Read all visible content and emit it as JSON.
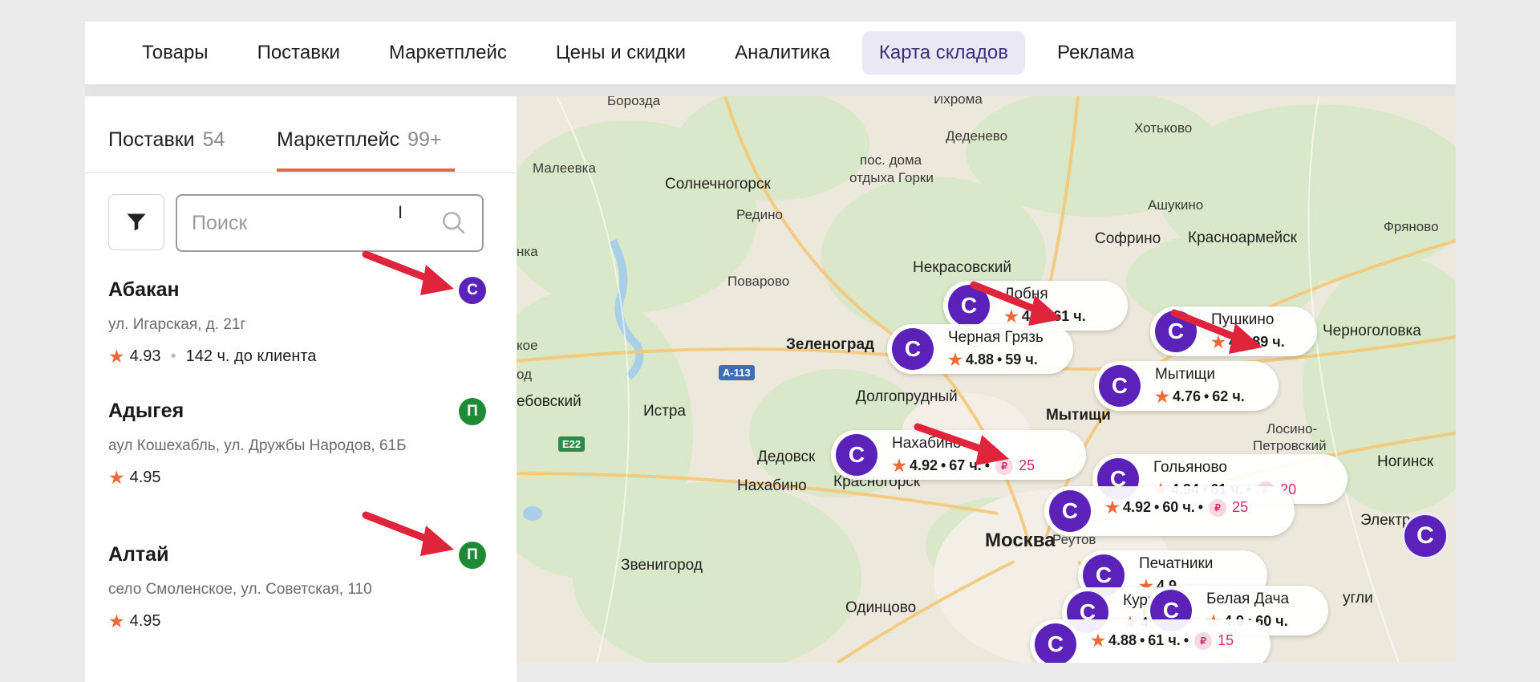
{
  "nav": {
    "items": [
      {
        "label": "Товары"
      },
      {
        "label": "Поставки"
      },
      {
        "label": "Маркетплейс"
      },
      {
        "label": "Цены и скидки"
      },
      {
        "label": "Аналитика"
      },
      {
        "label": "Карта складов",
        "active": true
      },
      {
        "label": "Реклама"
      }
    ]
  },
  "tabs": [
    {
      "label": "Поставки",
      "count": "54"
    },
    {
      "label": "Маркетплейс",
      "count": "99+",
      "active": true
    }
  ],
  "search": {
    "placeholder": "Поиск"
  },
  "warehouses": [
    {
      "name": "Абакан",
      "address": "ул. Игарская, д. 21г",
      "rating": "4.93",
      "delivery": "142 ч. до клиента",
      "badge": "С"
    },
    {
      "name": "Адыгея",
      "address": "аул Кошехабль, ул. Дружбы Народов, 61Б",
      "rating": "4.95",
      "badge": "П"
    },
    {
      "name": "Алтай",
      "address": "село Смоленское, ул. Советская, 110",
      "rating": "4.95",
      "badge": "П"
    }
  ],
  "map": {
    "places": [
      {
        "name": "Борозда"
      },
      {
        "name": "Ихрома"
      },
      {
        "name": "Деденево"
      },
      {
        "name": "Хотьково"
      },
      {
        "name": "Малеевка"
      },
      {
        "name": "пос. дома"
      },
      {
        "name": "отдыха Горки"
      },
      {
        "name": "Солнечногорск"
      },
      {
        "name": "Редино"
      },
      {
        "name": "Ашукино"
      },
      {
        "name": "Софрино"
      },
      {
        "name": "Красноармейск"
      },
      {
        "name": "Фряново"
      },
      {
        "name": "Поварово"
      },
      {
        "name": "Некрасовский"
      },
      {
        "name": "Зеленоград"
      },
      {
        "name": "Черноголовка"
      },
      {
        "name": "Долгопрудный"
      },
      {
        "name": "Мытищи"
      },
      {
        "name": "ебовский"
      },
      {
        "name": "Истра"
      },
      {
        "name": "Лосино-"
      },
      {
        "name": "Петровский"
      },
      {
        "name": "Дедовск"
      },
      {
        "name": "Ногинск"
      },
      {
        "name": "Нахабино"
      },
      {
        "name": "Москва"
      },
      {
        "name": "Электр"
      },
      {
        "name": "Звенигород"
      },
      {
        "name": "Одинцово"
      },
      {
        "name": "угли"
      },
      {
        "name": "Реутов"
      },
      {
        "name": "кое"
      },
      {
        "name": "од"
      },
      {
        "name": "нка"
      },
      {
        "name": "Красногорск"
      }
    ],
    "roads": [
      {
        "label": "А-113"
      },
      {
        "label": "E22"
      }
    ],
    "cards": [
      {
        "name": "Лобня",
        "rating": "4.8",
        "hours": "61 ч."
      },
      {
        "name": "Черная Грязь",
        "rating": "4.88",
        "hours": "59 ч."
      },
      {
        "name": "Пушкино",
        "rating": "4.",
        "hours": "89 ч."
      },
      {
        "name": "Мытищи",
        "rating": "4.76",
        "hours": "62 ч."
      },
      {
        "name": "Нахабино",
        "rating": "4.92",
        "hours": "67 ч.",
        "price": "25"
      },
      {
        "name": "Гольяново",
        "rating": "4.94",
        "hours": "61 ч.",
        "price": "20"
      },
      {
        "name": "",
        "rating": "4.92",
        "hours": "60 ч.",
        "price": "25"
      },
      {
        "name": "Печатники",
        "rating": "4.9",
        "hours": "",
        "price": ""
      },
      {
        "name": "Курь",
        "rating": "4.9",
        "hours": ""
      },
      {
        "name": "Белая Дача",
        "rating": "4.9",
        "hours": "60 ч."
      },
      {
        "name": "",
        "rating": "4.88",
        "hours": "61 ч.",
        "price": "15"
      }
    ],
    "marker_letter": "С",
    "sep": "•",
    "rub_sign": "₽"
  },
  "colors": {
    "accent": "#e8673d",
    "brand_purple": "#5a22b8",
    "green_badge": "#1f8a36",
    "arrow": "#e0243b"
  }
}
